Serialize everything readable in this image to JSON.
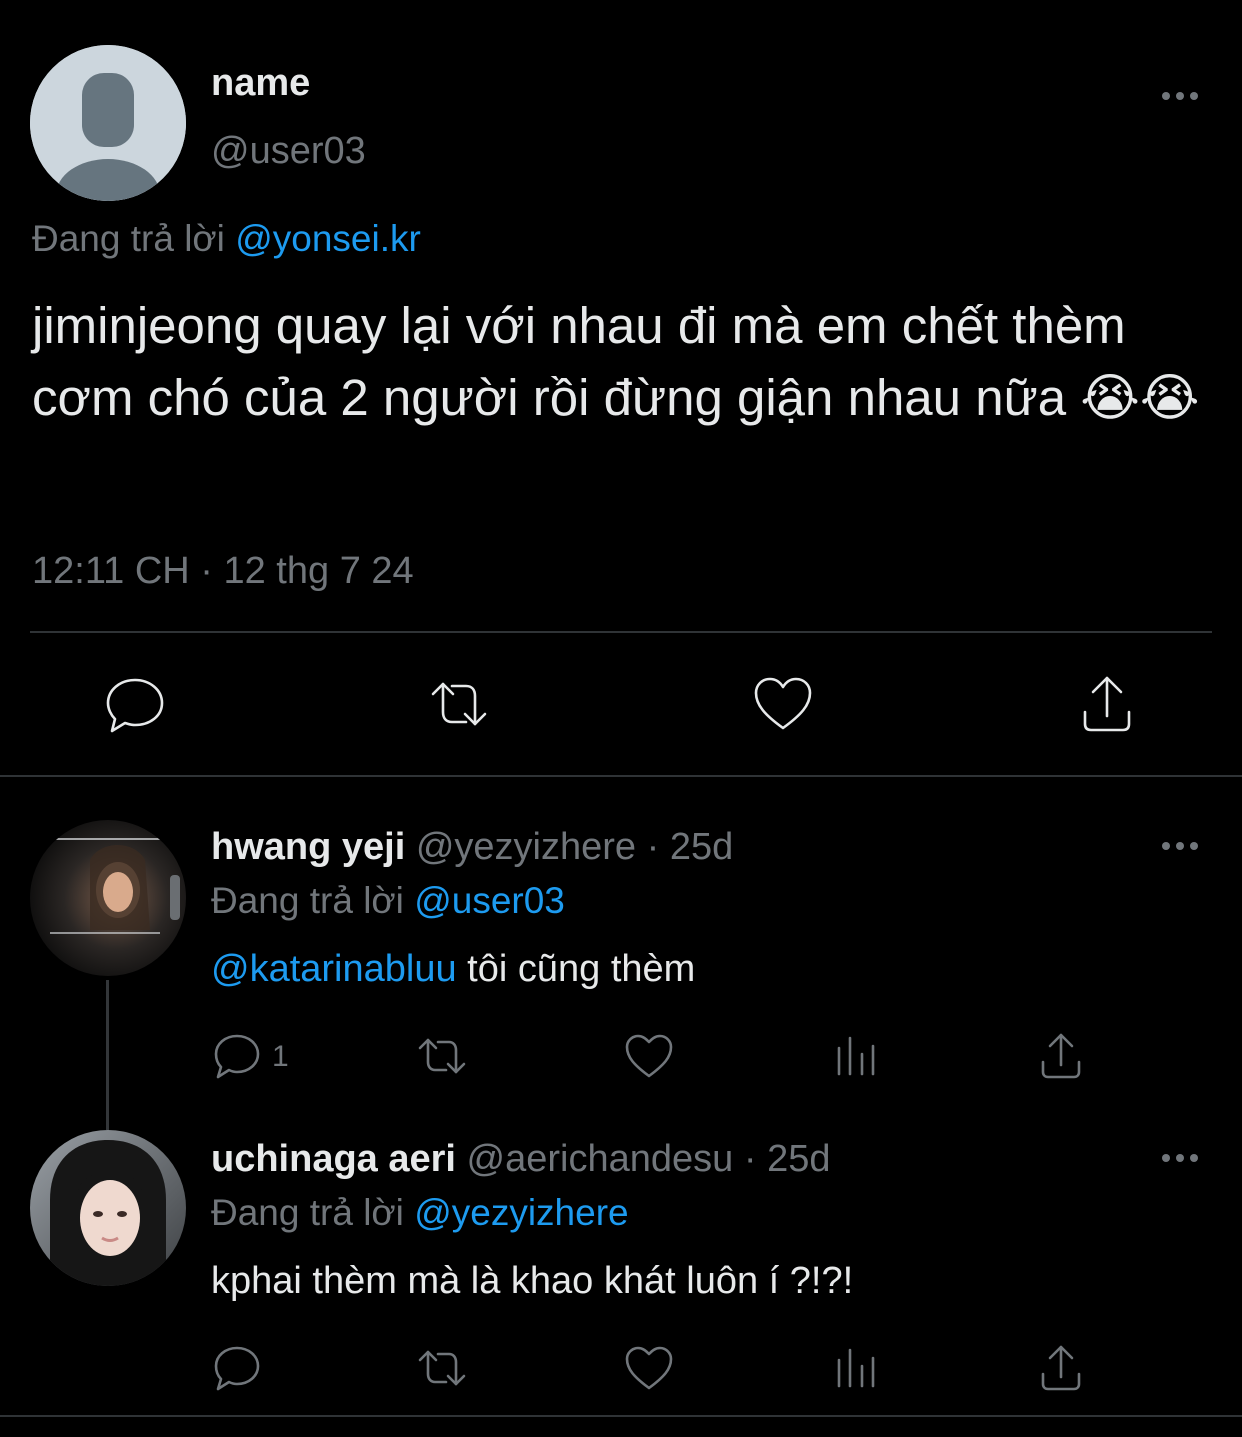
{
  "main_tweet": {
    "name": "name",
    "handle": "@user03",
    "replying_prefix": "Đang trả lời",
    "replying_to": "@yonsei.kr",
    "text": "jiminjeong quay lại với nhau đi mà em chết thèm cơm chó của 2 người rồi đừng giận nhau nữa 😭😭",
    "timestamp": "12:11 CH · 12 thg 7 24",
    "actions": [
      "reply-icon",
      "retweet-icon",
      "like-icon",
      "share-icon"
    ]
  },
  "replies": [
    {
      "name": "hwang yeji",
      "handle": "@yezyizhere",
      "age": "· 25d",
      "replying_prefix": "Đang trả lời",
      "replying_to": "@user03",
      "mention": "@katarinabluu",
      "text": " tôi cũng thèm",
      "reply_count": "1"
    },
    {
      "name": "uchinaga aeri",
      "handle": "@aerichandesu",
      "age": "· 25d",
      "replying_prefix": "Đang trả lời",
      "replying_to": "@yezyizhere",
      "text": "kphai thèm mà là khao khát luôn í ?!?!"
    }
  ],
  "colors": {
    "background": "#000000",
    "text": "#e7e9ea",
    "muted": "#71767b",
    "link": "#1d9bf0"
  }
}
